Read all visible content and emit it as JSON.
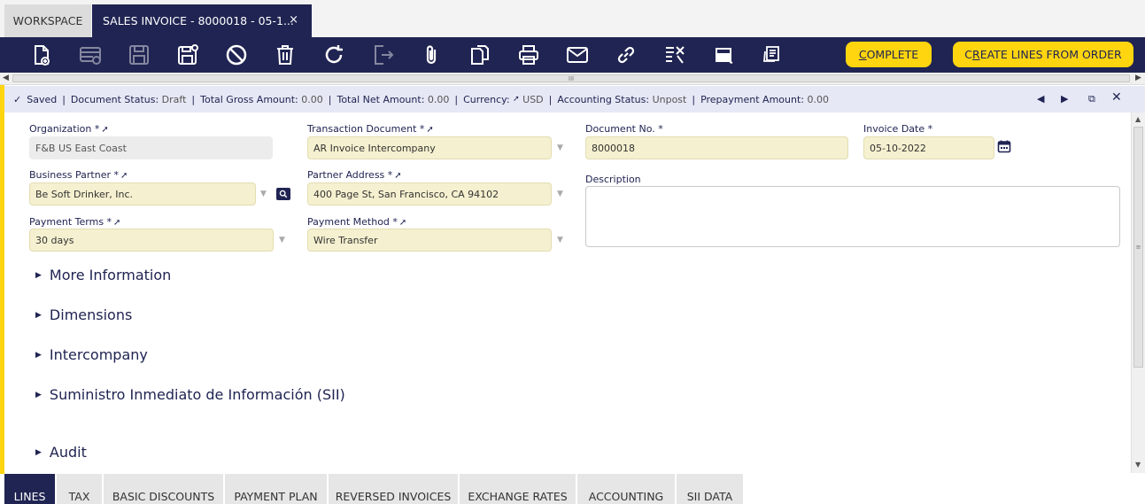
{
  "tabs": {
    "workspace": "WORKSPACE",
    "active": "SALES INVOICE - 8000018 - 05-1...",
    "close": "×"
  },
  "toolbar": {
    "icons": [
      "new-document-icon",
      "new-row-icon",
      "save-icon",
      "save-close-icon",
      "undo-icon",
      "delete-icon",
      "refresh-icon",
      "export-icon",
      "attachment-icon",
      "copy-record-icon",
      "print-icon",
      "email-icon",
      "link-icon",
      "audit-icon",
      "grid-view-icon",
      "notes-icon"
    ],
    "complete_u": "C",
    "complete_rest": "OMPLETE",
    "create_lines_u": "R",
    "create_lines_pre": "C",
    "create_lines_rest": "EATE LINES FROM ORDER",
    "accent": "#ffd50f",
    "brand": "#202452"
  },
  "hscroll": {
    "left": "◀",
    "right": "▶",
    "grip": "III"
  },
  "status": {
    "saved": "Saved",
    "doc_status_label": "Document Status:",
    "doc_status_value": "Draft",
    "gross_label": "Total Gross Amount:",
    "gross_value": "0.00",
    "net_label": "Total Net Amount:",
    "net_value": "0.00",
    "currency_label": "Currency:",
    "currency_value": "USD",
    "acct_label": "Accounting Status:",
    "acct_value": "Unpost",
    "prepay_label": "Prepayment Amount:",
    "prepay_value": "0.00"
  },
  "form": {
    "organization_label": "Organization *",
    "organization_value": "F&B US East Coast",
    "transaction_doc_label": "Transaction Document *",
    "transaction_doc_value": "AR Invoice Intercompany",
    "document_no_label": "Document No. *",
    "document_no_value": "8000018",
    "invoice_date_label": "Invoice Date *",
    "invoice_date_value": "05-10-2022",
    "business_partner_label": "Business Partner *",
    "business_partner_value": "Be Soft Drinker, Inc.",
    "partner_address_label": "Partner Address *",
    "partner_address_value": "400 Page St, San Francisco, CA 94102",
    "description_label": "Description",
    "payment_terms_label": "Payment Terms *",
    "payment_terms_value": "30 days",
    "payment_method_label": "Payment Method *",
    "payment_method_value": "Wire Transfer"
  },
  "sections": [
    "More Information",
    "Dimensions",
    "Intercompany",
    "Suministro Inmediato de Información (SII)",
    "Audit"
  ],
  "bottom_tabs": [
    "LINES",
    "TAX",
    "BASIC DISCOUNTS",
    "PAYMENT PLAN",
    "REVERSED INVOICES",
    "EXCHANGE RATES",
    "ACCOUNTING",
    "SII DATA"
  ]
}
